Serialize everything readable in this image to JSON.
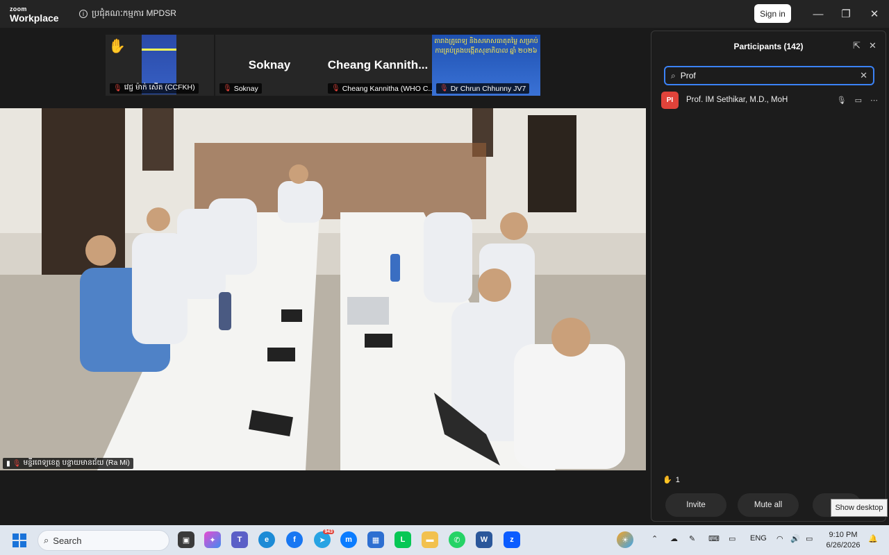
{
  "window": {
    "logo_line1": "zoom",
    "logo_line2": "Workplace",
    "meeting_title": "ប្រជុំគណៈកម្មការ MPDSR",
    "sign_in": "Sign in",
    "minimize": "—",
    "restore": "❐",
    "close": "✕"
  },
  "thumbnails": [
    {
      "name": "វេជ្ជ ម៉ាក់ សេីត (CCFKH)",
      "hand": "✋",
      "big_name": ""
    },
    {
      "name": "Soknay",
      "big_name": "Soknay"
    },
    {
      "name": "Cheang Kannitha (WHO C...",
      "big_name": "Cheang  Kannith..."
    },
    {
      "name": "Dr Chrun Chhunny JV7",
      "poster_text": "តារាងគ្រូពេទ្យ និងសមាសធាតុតម្លៃ សម្រាប់ការគ្រប់គ្រងបង្កើតសុខាភិបាល ឆ្នាំ ២០២៦"
    }
  ],
  "main_video": {
    "name": "មន្ទីរពេទ្យខេត្ត បន្ទាយមានជ័យ (Ra Mi)"
  },
  "participants": {
    "title": "Participants (142)",
    "search_value": "Prof",
    "list": [
      {
        "initials": "PI",
        "name": "Prof. IM Sethikar, M.D., MoH"
      }
    ],
    "raised_hands": "1",
    "buttons": {
      "invite": "Invite",
      "mute_all": "Mute all"
    }
  },
  "tooltip": "Show desktop",
  "taskbar": {
    "search_label": "Search",
    "telegram_badge": "943",
    "language": "ENG",
    "time": "9:10 PM",
    "date": "6/26/2026"
  },
  "colors": {
    "accent": "#3b82f6",
    "muted_red": "#e0433a"
  }
}
